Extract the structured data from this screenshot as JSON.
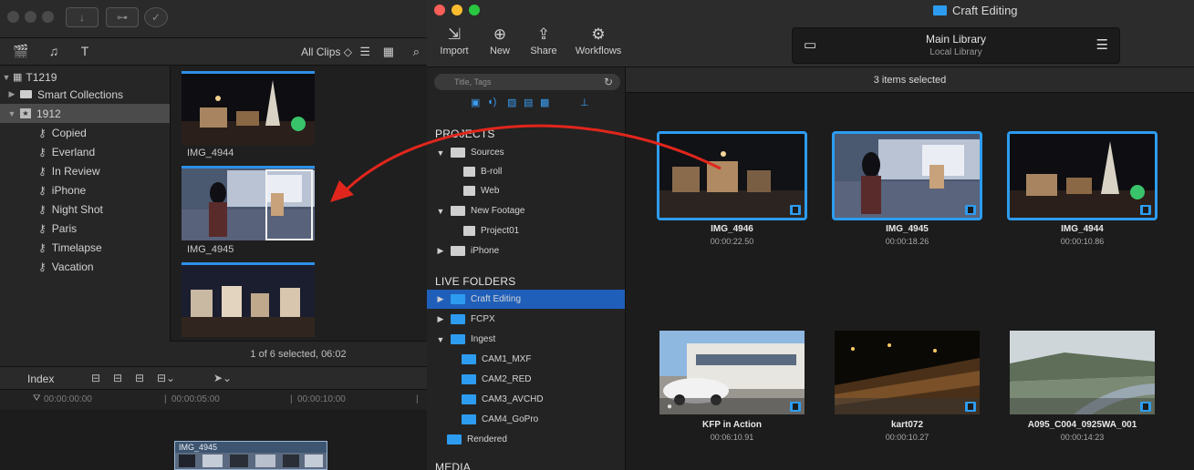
{
  "fcp": {
    "browser_filter": "All Clips ◇",
    "library": {
      "name": "T1219",
      "items": [
        {
          "label": "Smart Collections"
        },
        {
          "label": "1912"
        }
      ],
      "keywords": [
        "Copied",
        "Everland",
        "In Review",
        "iPhone",
        "Night Shot",
        "Paris",
        "Timelapse",
        "Vacation"
      ]
    },
    "clips": [
      {
        "name": "IMG_4944"
      },
      {
        "name": "IMG_4945"
      }
    ],
    "footer": "1 of 6 selected, 06:02",
    "timeline": {
      "index_label": "Index",
      "timecodes": [
        "00:00:00:00",
        "00:00:05:00",
        "00:00:10:00"
      ],
      "clip_name": "IMG_4945"
    }
  },
  "app": {
    "window_title": "Craft Editing",
    "toolbar": [
      {
        "label": "Import",
        "icon": "import-icon",
        "glyph": "⇲"
      },
      {
        "label": "New",
        "icon": "new-icon",
        "glyph": "⊕"
      },
      {
        "label": "Share",
        "icon": "share-icon",
        "glyph": "⇪"
      },
      {
        "label": "Workflows",
        "icon": "workflows-icon",
        "glyph": "⚙"
      }
    ],
    "library": {
      "title": "Main Library",
      "subtitle": "Local Library"
    },
    "search_placeholder": "Title, Tags",
    "sections": {
      "projects": "PROJECTS",
      "live_folders": "LIVE FOLDERS",
      "media": "MEDIA"
    },
    "projects": [
      "Sources",
      "B-roll",
      "Web",
      "New Footage",
      "Project01",
      "iPhone"
    ],
    "live_folders": [
      "Craft Editing",
      "FCPX",
      "Ingest",
      "CAM1_MXF",
      "CAM2_RED",
      "CAM3_AVCHD",
      "CAM4_GoPro",
      "Rendered"
    ],
    "selection_status": "3 items selected",
    "tiles": [
      {
        "name": "IMG_4946",
        "duration": "00:00:22.50",
        "selected": true
      },
      {
        "name": "IMG_4945",
        "duration": "00:00:18.26",
        "selected": true
      },
      {
        "name": "IMG_4944",
        "duration": "00:00:10.86",
        "selected": true
      },
      {
        "name": "KFP in Action",
        "duration": "00:06:10.91",
        "selected": false
      },
      {
        "name": "kart072",
        "duration": "00:00:10.27",
        "selected": false
      },
      {
        "name": "A095_C004_0925WA_001",
        "duration": "00:00:14:23",
        "selected": false
      }
    ],
    "colors": {
      "accent": "#2d9cf0",
      "selection": "#1f5fba",
      "arrow": "#e0261c"
    }
  }
}
